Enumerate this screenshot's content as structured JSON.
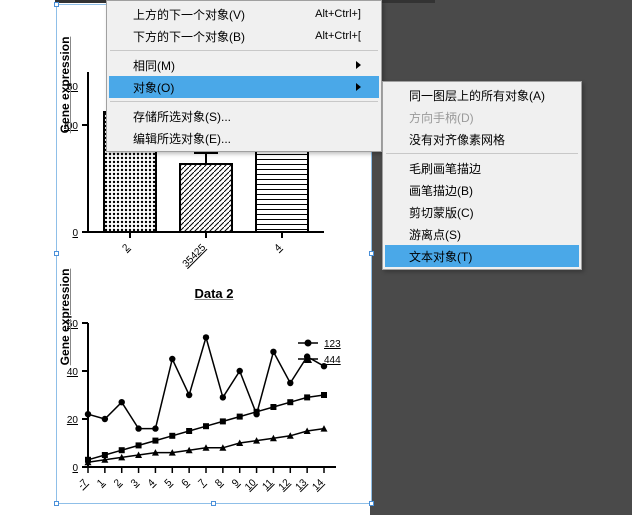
{
  "menu1": {
    "items": [
      {
        "label": "上方的下一个对象(V)",
        "shortcut": "Alt+Ctrl+]",
        "arrow": false,
        "sep": false
      },
      {
        "label": "下方的下一个对象(B)",
        "shortcut": "Alt+Ctrl+[",
        "arrow": false,
        "sep": true
      },
      {
        "label": "相同(M)",
        "arrow": true,
        "sep": false
      },
      {
        "label": "对象(O)",
        "arrow": true,
        "highlight": true,
        "sep": true
      },
      {
        "label": "存储所选对象(S)...",
        "sep": false
      },
      {
        "label": "编辑所选对象(E)...",
        "sep": false
      }
    ]
  },
  "menu2": {
    "items": [
      {
        "label": "同一图层上的所有对象(A)"
      },
      {
        "label": "方向手柄(D)",
        "disabled": true
      },
      {
        "label": "没有对齐像素网格",
        "sep": true
      },
      {
        "label": "毛刷画笔描边"
      },
      {
        "label": "画笔描边(B)"
      },
      {
        "label": "剪切蒙版(C)"
      },
      {
        "label": "游离点(S)"
      },
      {
        "label": "文本对象(T)",
        "highlight": true
      }
    ]
  },
  "chart_data": [
    {
      "type": "bar",
      "title": "",
      "ylabel": "Gene expression",
      "ylim": [
        0,
        300
      ],
      "yticks": [
        0,
        200,
        60
      ],
      "categories": [
        "2",
        "35425",
        "4"
      ],
      "values": [
        225,
        128,
        210
      ],
      "errors": [
        30,
        20,
        50
      ]
    },
    {
      "type": "line",
      "title": "Data 2",
      "ylabel": "Gene expression",
      "ylim": [
        0,
        60
      ],
      "yticks": [
        0,
        20,
        40,
        60
      ],
      "x": [
        -7,
        1,
        2,
        3,
        4,
        5,
        6,
        7,
        8,
        9,
        10,
        11,
        12,
        13,
        14
      ],
      "series": [
        {
          "name": "123",
          "marker": "circle",
          "values": [
            22,
            20,
            27,
            16,
            16,
            45,
            30,
            54,
            29,
            40,
            22,
            48,
            35,
            46,
            42
          ]
        },
        {
          "name": "444",
          "marker": "square",
          "values": [
            3,
            5,
            7,
            9,
            11,
            13,
            15,
            17,
            19,
            21,
            23,
            25,
            27,
            29,
            30
          ]
        },
        {
          "name": "",
          "marker": "triangle",
          "values": [
            2,
            3,
            4,
            5,
            6,
            6,
            7,
            8,
            8,
            10,
            11,
            12,
            13,
            15,
            16
          ]
        }
      ]
    }
  ]
}
